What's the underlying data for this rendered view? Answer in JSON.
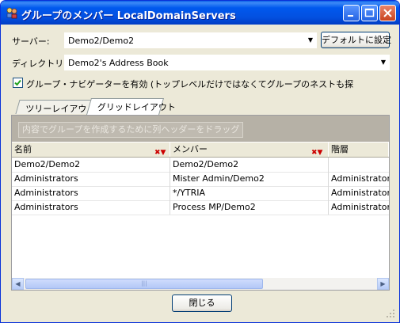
{
  "window": {
    "title": "グループのメンバー LocalDomainServers",
    "icon": "group-members-icon"
  },
  "form": {
    "server_label": "サーバー:",
    "server_value": "Demo2/Demo2",
    "default_button": "デフォルトに設定",
    "directory_label": "ディレクトリ:",
    "directory_value": "Demo2's Address Book",
    "navigator_checkbox_label": "グループ・ナビゲーターを有効 (トップレベルだけではなくてグループのネストも探",
    "navigator_checked": true
  },
  "tabs": [
    {
      "label": "ツリーレイアウト",
      "active": false
    },
    {
      "label": "グリッドレイアウト",
      "active": true
    }
  ],
  "grid": {
    "group_hint": "内容でグループを作成するために列ヘッダーをドラッグ",
    "columns": [
      "名前",
      "メンバー",
      "階層"
    ],
    "rows": [
      [
        "Demo2/Demo2",
        "Demo2/Demo2",
        ""
      ],
      [
        "Administrators",
        "Mister Admin/Demo2",
        "Administrators"
      ],
      [
        "Administrators",
        "*/YTRIA",
        "Administrators"
      ],
      [
        "Administrators",
        "Process MP/Demo2",
        "Administrators"
      ]
    ]
  },
  "footer": {
    "close_button": "閉じる"
  }
}
